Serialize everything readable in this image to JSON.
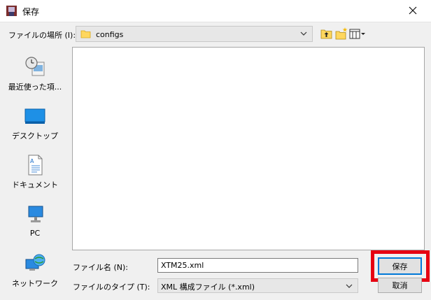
{
  "window": {
    "title": "保存"
  },
  "look_in": {
    "label": "ファイルの場所 (I):",
    "value": "configs"
  },
  "places": [
    {
      "label": "最近使った項..."
    },
    {
      "label": "デスクトップ"
    },
    {
      "label": "ドキュメント"
    },
    {
      "label": "PC"
    },
    {
      "label": "ネットワーク"
    }
  ],
  "file_name": {
    "label": "ファイル名 (N):",
    "value": "XTM25.xml"
  },
  "file_type": {
    "label": "ファイルのタイプ (T):",
    "value": "XML 構成ファイル (*.xml)"
  },
  "buttons": {
    "save": "保存",
    "cancel": "取消"
  },
  "colors": {
    "highlight": "#e60012",
    "focus": "#0078d7",
    "folder": "#ffd75e"
  }
}
